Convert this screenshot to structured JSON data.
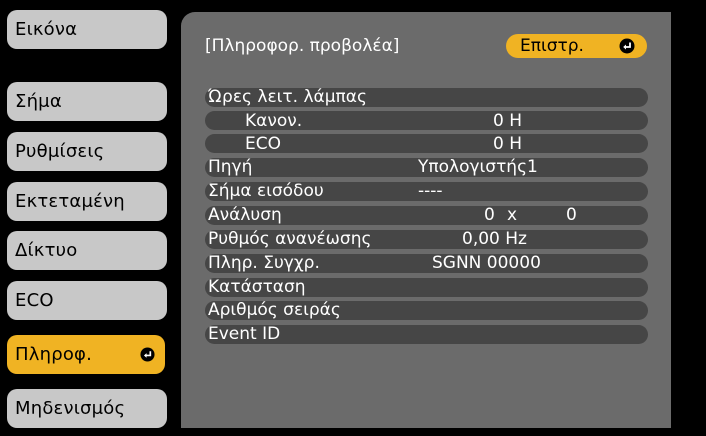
{
  "sidebar": {
    "items": [
      {
        "label": "Εικόνα"
      },
      {
        "label": "Σήμα"
      },
      {
        "label": "Ρυθμίσεις"
      },
      {
        "label": "Εκτεταμένη"
      },
      {
        "label": "Δίκτυο"
      },
      {
        "label": "ECO"
      },
      {
        "label": "Πληροφ.",
        "selected": true,
        "icon": "enter-icon"
      },
      {
        "label": "Μηδενισμός"
      }
    ]
  },
  "panel": {
    "title": "[Πληροφορ. προβολέα]",
    "back_button": {
      "label": "Επιστρ.",
      "icon": "enter-icon"
    },
    "rows": {
      "lamp_hours": {
        "label": "Ώρες λειτ. λάμπας"
      },
      "normal": {
        "label": "Κανον.",
        "value": "0 H"
      },
      "eco": {
        "label": "ECO",
        "value": "0 H"
      },
      "source": {
        "label": "Πηγή",
        "value": "Υπολογιστής1"
      },
      "input_signal": {
        "label": "Σήμα εισόδου",
        "value": "----"
      },
      "resolution": {
        "label": "Ανάλυση",
        "value_x": "0",
        "value_sep": "x",
        "value_y": "0"
      },
      "refresh_rate": {
        "label": "Ρυθμός ανανέωσης",
        "value": "0,00 Hz"
      },
      "sync_info": {
        "label": "Πληρ. Συγχρ.",
        "value": "SGNN 00000"
      },
      "status": {
        "label": "Κατάσταση"
      },
      "serial_number": {
        "label": "Αριθμός σειράς"
      },
      "event_id": {
        "label": "Event ID"
      }
    }
  },
  "colors": {
    "background": "#000000",
    "sidebar_item": "#c8c8c8",
    "selected": "#f0b323",
    "panel": "#6b6b6b",
    "row": "#464646",
    "text_light": "#ffffff"
  }
}
